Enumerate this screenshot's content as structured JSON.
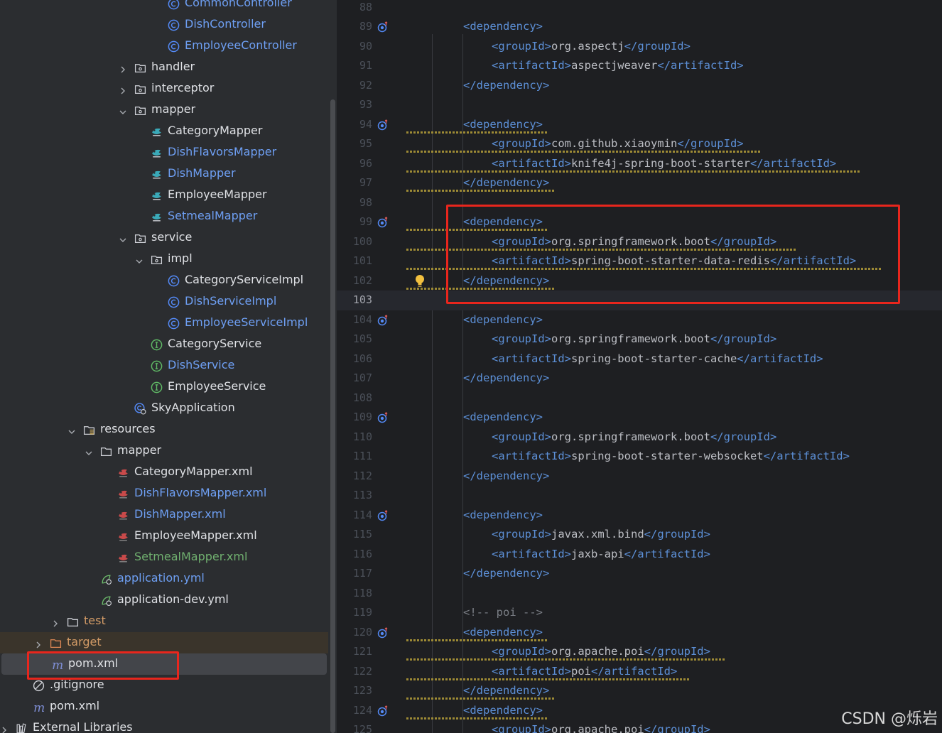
{
  "tree": {
    "rows": [
      {
        "label": "CommonController",
        "icon": "class-icon",
        "color": "blue",
        "indent": 236,
        "arrow": "none",
        "style": ""
      },
      {
        "label": "DishController",
        "icon": "class-icon",
        "color": "blue",
        "indent": 236,
        "arrow": "none",
        "style": ""
      },
      {
        "label": "EmployeeController",
        "icon": "class-icon",
        "color": "blue",
        "indent": 236,
        "arrow": "none",
        "style": ""
      },
      {
        "label": "handler",
        "icon": "package-icon",
        "color": "",
        "indent": 189,
        "arrow": "right",
        "style": ""
      },
      {
        "label": "interceptor",
        "icon": "package-icon",
        "color": "",
        "indent": 189,
        "arrow": "right",
        "style": ""
      },
      {
        "label": "mapper",
        "icon": "package-icon",
        "color": "",
        "indent": 189,
        "arrow": "down",
        "style": ""
      },
      {
        "label": "CategoryMapper",
        "icon": "mapper-interface-icon",
        "color": "",
        "indent": 212,
        "arrow": "none",
        "style": ""
      },
      {
        "label": "DishFlavorsMapper",
        "icon": "mapper-interface-icon",
        "color": "blue",
        "indent": 212,
        "arrow": "none",
        "style": ""
      },
      {
        "label": "DishMapper",
        "icon": "mapper-interface-icon",
        "color": "blue",
        "indent": 212,
        "arrow": "none",
        "style": ""
      },
      {
        "label": "EmployeeMapper",
        "icon": "mapper-interface-icon",
        "color": "",
        "indent": 212,
        "arrow": "none",
        "style": ""
      },
      {
        "label": "SetmealMapper",
        "icon": "mapper-interface-icon",
        "color": "blue",
        "indent": 212,
        "arrow": "none",
        "style": ""
      },
      {
        "label": "service",
        "icon": "package-icon",
        "color": "",
        "indent": 189,
        "arrow": "down",
        "style": ""
      },
      {
        "label": "impl",
        "icon": "package-icon",
        "color": "",
        "indent": 212,
        "arrow": "down",
        "style": ""
      },
      {
        "label": "CategoryServiceImpl",
        "icon": "class-icon",
        "color": "",
        "indent": 236,
        "arrow": "none",
        "style": ""
      },
      {
        "label": "DishServiceImpl",
        "icon": "class-icon",
        "color": "blue",
        "indent": 236,
        "arrow": "none",
        "style": ""
      },
      {
        "label": "EmployeeServiceImpl",
        "icon": "class-icon",
        "color": "blue",
        "indent": 236,
        "arrow": "none",
        "style": ""
      },
      {
        "label": "CategoryService",
        "icon": "interface-icon",
        "color": "",
        "indent": 212,
        "arrow": "none",
        "style": ""
      },
      {
        "label": "DishService",
        "icon": "interface-icon",
        "color": "blue",
        "indent": 212,
        "arrow": "none",
        "style": ""
      },
      {
        "label": "EmployeeService",
        "icon": "interface-icon",
        "color": "",
        "indent": 212,
        "arrow": "none",
        "style": ""
      },
      {
        "label": "SkyApplication",
        "icon": "spring-boot-class-icon",
        "color": "",
        "indent": 189,
        "arrow": "none",
        "style": ""
      },
      {
        "label": "resources",
        "icon": "resources-folder-icon",
        "color": "",
        "indent": 117,
        "arrow": "down",
        "style": ""
      },
      {
        "label": "mapper",
        "icon": "folder-icon",
        "color": "",
        "indent": 141,
        "arrow": "down",
        "style": ""
      },
      {
        "label": "CategoryMapper.xml",
        "icon": "mybatis-xml-icon",
        "color": "",
        "indent": 165,
        "arrow": "none",
        "style": ""
      },
      {
        "label": "DishFlavorsMapper.xml",
        "icon": "mybatis-xml-icon",
        "color": "blue",
        "indent": 165,
        "arrow": "none",
        "style": ""
      },
      {
        "label": "DishMapper.xml",
        "icon": "mybatis-xml-icon",
        "color": "blue",
        "indent": 165,
        "arrow": "none",
        "style": ""
      },
      {
        "label": "EmployeeMapper.xml",
        "icon": "mybatis-xml-icon",
        "color": "",
        "indent": 165,
        "arrow": "none",
        "style": ""
      },
      {
        "label": "SetmealMapper.xml",
        "icon": "mybatis-xml-icon",
        "color": "green",
        "indent": 165,
        "arrow": "none",
        "style": ""
      },
      {
        "label": "application.yml",
        "icon": "spring-config-icon",
        "color": "blue",
        "indent": 141,
        "arrow": "none",
        "style": ""
      },
      {
        "label": "application-dev.yml",
        "icon": "spring-config-icon",
        "color": "",
        "indent": 141,
        "arrow": "none",
        "style": ""
      },
      {
        "label": "test",
        "icon": "folder-icon",
        "color": "orange",
        "indent": 94,
        "arrow": "right",
        "style": ""
      },
      {
        "label": "target",
        "icon": "excluded-folder-icon",
        "color": "orange",
        "indent": 70,
        "arrow": "right",
        "style": "dim"
      },
      {
        "label": "pom.xml",
        "icon": "maven-icon",
        "color": "",
        "indent": 70,
        "arrow": "none",
        "style": "sel"
      },
      {
        "label": ".gitignore",
        "icon": "ignore-file-icon",
        "color": "",
        "indent": 46,
        "arrow": "none",
        "style": ""
      },
      {
        "label": "pom.xml",
        "icon": "maven-icon",
        "color": "",
        "indent": 46,
        "arrow": "none",
        "style": ""
      },
      {
        "label": "External Libraries",
        "icon": "library-icon",
        "color": "",
        "indent": 22,
        "arrow": "right",
        "style": ""
      }
    ]
  },
  "editor": {
    "current_line": 103,
    "lines": [
      {
        "n": 88,
        "indent": 0,
        "parts": []
      },
      {
        "n": 89,
        "gutter": "maven-dependency-icon",
        "indent": 1,
        "parts": [
          [
            "tg",
            "<dependency>"
          ]
        ]
      },
      {
        "n": 90,
        "indent": 2,
        "parts": [
          [
            "tg",
            "<groupId>"
          ],
          [
            "tx",
            "org.aspectj"
          ],
          [
            "tg",
            "</groupId>"
          ]
        ]
      },
      {
        "n": 91,
        "indent": 2,
        "parts": [
          [
            "tg",
            "<artifactId>"
          ],
          [
            "tx",
            "aspectjweaver"
          ],
          [
            "tg",
            "</artifactId>"
          ]
        ]
      },
      {
        "n": 92,
        "indent": 1,
        "parts": [
          [
            "tg",
            "</dependency>"
          ]
        ]
      },
      {
        "n": 93,
        "indent": 0,
        "parts": []
      },
      {
        "n": 94,
        "gutter": "maven-dependency-icon",
        "indent": 1,
        "warn": true,
        "parts": [
          [
            "tg",
            "<dependency>"
          ]
        ]
      },
      {
        "n": 95,
        "indent": 2,
        "warn": true,
        "parts": [
          [
            "tg",
            "<groupId>"
          ],
          [
            "tx",
            "com.github.xiaoymin"
          ],
          [
            "tg",
            "</groupId>"
          ]
        ]
      },
      {
        "n": 96,
        "indent": 2,
        "warn": true,
        "parts": [
          [
            "tg",
            "<artifactId>"
          ],
          [
            "tx",
            "knife4j-spring-boot-starter"
          ],
          [
            "tg",
            "</artifactId>"
          ]
        ]
      },
      {
        "n": 97,
        "indent": 1,
        "warn": true,
        "parts": [
          [
            "tg",
            "</dependency>"
          ]
        ]
      },
      {
        "n": 98,
        "indent": 0,
        "parts": []
      },
      {
        "n": 99,
        "gutter": "maven-dependency-icon",
        "indent": 1,
        "warn": true,
        "parts": [
          [
            "tg",
            "<dependency>"
          ]
        ]
      },
      {
        "n": 100,
        "indent": 2,
        "warn": true,
        "parts": [
          [
            "tg",
            "<groupId>"
          ],
          [
            "tx",
            "org.springframework.boot"
          ],
          [
            "tg",
            "</groupId>"
          ]
        ]
      },
      {
        "n": 101,
        "indent": 2,
        "warn": true,
        "parts": [
          [
            "tg",
            "<artifactId>"
          ],
          [
            "tx",
            "spring-boot-starter-data-redis"
          ],
          [
            "tg",
            "</artifactId>"
          ]
        ]
      },
      {
        "n": 102,
        "indent": 1,
        "warn": true,
        "bulb": true,
        "parts": [
          [
            "tg",
            "</dependency>"
          ]
        ]
      },
      {
        "n": 103,
        "indent": 0,
        "parts": []
      },
      {
        "n": 104,
        "gutter": "maven-dependency-icon",
        "indent": 1,
        "parts": [
          [
            "tg",
            "<dependency>"
          ]
        ]
      },
      {
        "n": 105,
        "indent": 2,
        "parts": [
          [
            "tg",
            "<groupId>"
          ],
          [
            "tx",
            "org.springframework.boot"
          ],
          [
            "tg",
            "</groupId>"
          ]
        ]
      },
      {
        "n": 106,
        "indent": 2,
        "parts": [
          [
            "tg",
            "<artifactId>"
          ],
          [
            "tx",
            "spring-boot-starter-cache"
          ],
          [
            "tg",
            "</artifactId>"
          ]
        ]
      },
      {
        "n": 107,
        "indent": 1,
        "parts": [
          [
            "tg",
            "</dependency>"
          ]
        ]
      },
      {
        "n": 108,
        "indent": 0,
        "parts": []
      },
      {
        "n": 109,
        "gutter": "maven-dependency-icon",
        "indent": 1,
        "parts": [
          [
            "tg",
            "<dependency>"
          ]
        ]
      },
      {
        "n": 110,
        "indent": 2,
        "parts": [
          [
            "tg",
            "<groupId>"
          ],
          [
            "tx",
            "org.springframework.boot"
          ],
          [
            "tg",
            "</groupId>"
          ]
        ]
      },
      {
        "n": 111,
        "indent": 2,
        "parts": [
          [
            "tg",
            "<artifactId>"
          ],
          [
            "tx",
            "spring-boot-starter-websocket"
          ],
          [
            "tg",
            "</artifactId>"
          ]
        ]
      },
      {
        "n": 112,
        "indent": 1,
        "parts": [
          [
            "tg",
            "</dependency>"
          ]
        ]
      },
      {
        "n": 113,
        "indent": 0,
        "parts": []
      },
      {
        "n": 114,
        "gutter": "maven-dependency-icon",
        "indent": 1,
        "parts": [
          [
            "tg",
            "<dependency>"
          ]
        ]
      },
      {
        "n": 115,
        "indent": 2,
        "parts": [
          [
            "tg",
            "<groupId>"
          ],
          [
            "tx",
            "javax.xml.bind"
          ],
          [
            "tg",
            "</groupId>"
          ]
        ]
      },
      {
        "n": 116,
        "indent": 2,
        "parts": [
          [
            "tg",
            "<artifactId>"
          ],
          [
            "tx",
            "jaxb-api"
          ],
          [
            "tg",
            "</artifactId>"
          ]
        ]
      },
      {
        "n": 117,
        "indent": 1,
        "parts": [
          [
            "tg",
            "</dependency>"
          ]
        ]
      },
      {
        "n": 118,
        "indent": 0,
        "parts": []
      },
      {
        "n": 119,
        "indent": 1,
        "parts": [
          [
            "cm",
            "<!-- poi -->"
          ]
        ]
      },
      {
        "n": 120,
        "gutter": "maven-dependency-icon",
        "indent": 1,
        "warn": true,
        "parts": [
          [
            "tg",
            "<dependency>"
          ]
        ]
      },
      {
        "n": 121,
        "indent": 2,
        "warn": true,
        "parts": [
          [
            "tg",
            "<groupId>"
          ],
          [
            "tx",
            "org.apache.poi"
          ],
          [
            "tg",
            "</groupId>"
          ]
        ]
      },
      {
        "n": 122,
        "indent": 2,
        "warn": true,
        "parts": [
          [
            "tg",
            "<artifactId>"
          ],
          [
            "tx",
            "poi"
          ],
          [
            "tg",
            "</artifactId>"
          ]
        ]
      },
      {
        "n": 123,
        "indent": 1,
        "warn": true,
        "parts": [
          [
            "tg",
            "</dependency>"
          ]
        ]
      },
      {
        "n": 124,
        "gutter": "maven-dependency-icon",
        "indent": 1,
        "warn": true,
        "parts": [
          [
            "tg",
            "<dependency>"
          ]
        ]
      },
      {
        "n": 125,
        "indent": 2,
        "warn": true,
        "parts": [
          [
            "tg",
            "<groupId>"
          ],
          [
            "tx",
            "org.apache.poi"
          ],
          [
            "tg",
            "</groupId>"
          ]
        ]
      }
    ]
  },
  "annotations": {
    "highlight_color": "#e8261d"
  },
  "watermark": "CSDN @烁岩"
}
